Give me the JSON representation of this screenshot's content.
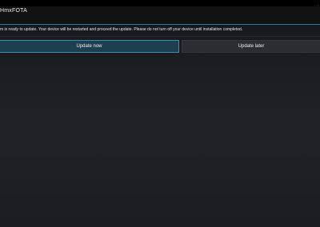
{
  "app": {
    "title": "HmxFOTA"
  },
  "dialog": {
    "message": "m is ready to update. Your device will be restarted and proceed the update. Please do not turn off your device until installation completed."
  },
  "buttons": {
    "update_now": "Update now",
    "update_later": "Update later"
  },
  "icons": {
    "status": "signal-icon"
  },
  "colors": {
    "accent": "#3a8fb0",
    "background": "#1a1c20",
    "primary_button": "#1d3f4f",
    "secondary_button": "#2c2d31"
  }
}
